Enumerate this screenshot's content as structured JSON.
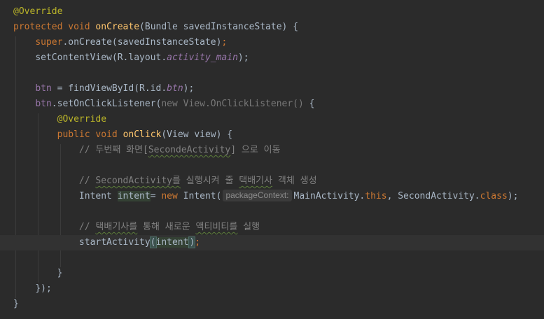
{
  "code": {
    "l1_annotation": "@Override",
    "l2_protected": "protected",
    "l2_void": "void",
    "l2_method": "onCreate",
    "l2_params": "(Bundle savedInstanceState) {",
    "l3_super": "super",
    "l3_call": ".onCreate(savedInstanceState)",
    "l3_semi": ";",
    "l4_call": "setContentView(R.layout.",
    "l4_field": "activity_main",
    "l4_end": ");",
    "l6_btn": "btn",
    "l6_mid": " = findViewById(R.id.",
    "l6_field": "btn",
    "l6_end": ");",
    "l7_btn": "btn",
    "l7_call": ".setOnClickListener(",
    "l7_new": "new View.OnClickListener()",
    "l7_end": " {",
    "l8_annotation": "@Override",
    "l9_public": "public",
    "l9_void": "void",
    "l9_method": "onClick",
    "l9_params": "(View view) {",
    "l10_comment_a": "// 두번째 화면[",
    "l10_comment_b": "SecondeActivity",
    "l10_comment_c": "] 으로 이동",
    "l12_comment_a": "// ",
    "l12_comment_b": "SecondActivity를",
    "l12_comment_c": " 실행시켜 줄 ",
    "l12_comment_d": "택배기사",
    "l12_comment_e": " 객체 생성",
    "l13_type": "Intent",
    "l13_var": "intent",
    "l13_assign": "= ",
    "l13_new": "new",
    "l13_ctor": " Intent(",
    "l13_hint": "packageContext:",
    "l13_arg1": "MainActivity.",
    "l13_this": "this",
    "l13_comma": ", SecondActivity.",
    "l13_class": "class",
    "l13_end": ");",
    "l15_comment_a": "// ",
    "l15_comment_b": "택배기사를",
    "l15_comment_c": " 통해 새로운 ",
    "l15_comment_d": "액티비티를",
    "l15_comment_e": " 실행",
    "l16_call": "startActivity",
    "l16_open": "(",
    "l16_arg_a": "intent",
    "l16_close": ")",
    "l16_semi": ";",
    "l18_brace": "}",
    "l19_close": "});",
    "l20_brace": "}"
  },
  "colors": {
    "background": "#2b2b2b",
    "default_text": "#a9b7c6",
    "keyword": "#cc7832",
    "method": "#ffc66d",
    "annotation": "#bbb529",
    "field": "#9876aa",
    "comment": "#808080"
  }
}
